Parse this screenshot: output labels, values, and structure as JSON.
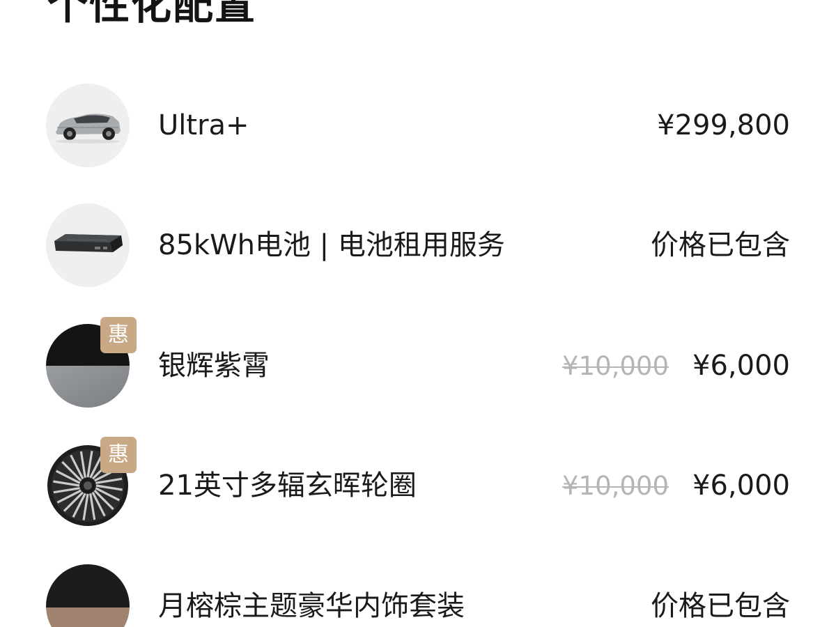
{
  "page": {
    "title": "个性化配置"
  },
  "items": [
    {
      "name": "Ultra+",
      "price": "¥299,800",
      "original_price": null,
      "badge": null,
      "thumb_icon": "car-suv-image"
    },
    {
      "name": "85kWh电池 | 电池租用服务",
      "price": "价格已包含",
      "original_price": null,
      "badge": null,
      "thumb_icon": "battery-pack-image"
    },
    {
      "name": "银辉紫霄",
      "price": "¥6,000",
      "original_price": "¥10,000",
      "badge": "惠",
      "thumb_icon": "paint-color-swatch"
    },
    {
      "name": "21英寸多辐玄晖轮圈",
      "price": "¥6,000",
      "original_price": "¥10,000",
      "badge": "惠",
      "thumb_icon": "wheel-rim-image"
    },
    {
      "name": "月榕棕主题豪华内饰套装",
      "price": "价格已包含",
      "original_price": null,
      "badge": null,
      "thumb_icon": "interior-color-swatch"
    }
  ],
  "colors": {
    "badge_bg": "#c9a985",
    "strike_price": "#b5b5b5",
    "text": "#1a1a1a",
    "swatch_top_dark": "#141414",
    "swatch_bottom_gray": "#8e9194",
    "interior_bottom_brown": "#a08470"
  }
}
